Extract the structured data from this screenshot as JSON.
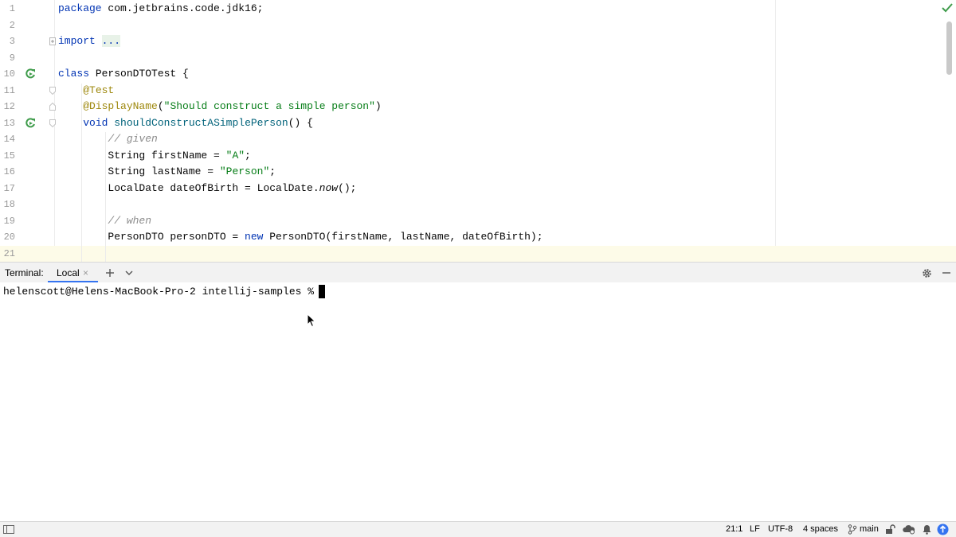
{
  "editor": {
    "lines": [
      {
        "number": "1",
        "text": "package com.jetbrains.code.jdk16;"
      },
      {
        "number": "2",
        "text": ""
      },
      {
        "number": "3",
        "text": "import ..."
      },
      {
        "number": "9",
        "text": ""
      },
      {
        "number": "10",
        "text": "class PersonDTOTest {"
      },
      {
        "number": "11",
        "text": "    @Test"
      },
      {
        "number": "12",
        "text": "    @DisplayName(\"Should construct a simple person\")"
      },
      {
        "number": "13",
        "text": "    void shouldConstructASimplePerson() {"
      },
      {
        "number": "14",
        "text": "        // given"
      },
      {
        "number": "15",
        "text": "        String firstName = \"A\";"
      },
      {
        "number": "16",
        "text": "        String lastName = \"Person\";"
      },
      {
        "number": "17",
        "text": "        LocalDate dateOfBirth = LocalDate.now();"
      },
      {
        "number": "18",
        "text": ""
      },
      {
        "number": "19",
        "text": "        // when"
      },
      {
        "number": "20",
        "text": "        PersonDTO personDTO = new PersonDTO(firstName, lastName, dateOfBirth);"
      },
      {
        "number": "21",
        "text": ""
      }
    ],
    "run_icon": "run-test-icon",
    "inspection_icon": "checkmark-icon"
  },
  "terminal": {
    "title": "Terminal:",
    "tab_label": "Local",
    "tab_close": "×",
    "add_icon": "plus-icon",
    "dropdown_icon": "chevron-down-icon",
    "settings_icon": "gear-icon",
    "minimize_icon": "minimize-icon",
    "prompt": "helenscott@Helens-MacBook-Pro-2 intellij-samples %"
  },
  "statusbar": {
    "position": "21:1",
    "line_separator": "LF",
    "encoding": "UTF-8",
    "indent": "4 spaces",
    "branch": "main"
  },
  "colors": {
    "keyword": "#0033b3",
    "string": "#067d17",
    "annotation": "#9e880d",
    "comment": "#8c8c8c",
    "method": "#00627a",
    "tab_underline": "#3574f0",
    "run_icon": "#3f9c4b"
  }
}
